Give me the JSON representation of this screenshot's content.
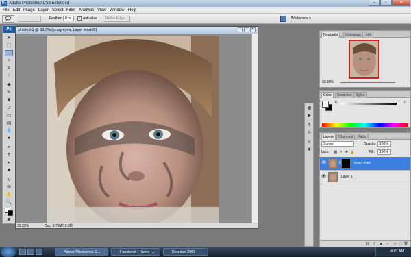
{
  "window": {
    "title": "Adobe Photoshop CS3 Extended",
    "app_badge": "Ps",
    "controls": {
      "minimize": "–",
      "maximize": "▫",
      "close": "✕"
    }
  },
  "menu": [
    "File",
    "Edit",
    "Image",
    "Layer",
    "Select",
    "Filter",
    "Analysis",
    "View",
    "Window",
    "Help"
  ],
  "options": {
    "tool_icon": "lasso-icon",
    "feather_label": "Feather:",
    "feather_value": "0 px",
    "antialias_label": "Anti-alias",
    "antialias_checked": true,
    "refine_edge_label": "Refine Edge...",
    "workspace_label": "Workspace ▾"
  },
  "document": {
    "title": "Untitled-1 @ 33.3% (scary eyes, Layer Mask/8)",
    "zoom": "33.33%",
    "doc_info": "Doc: 9.76M/19.0M"
  },
  "panels": {
    "navigator": {
      "tabs": [
        "Navigator",
        "Histogram",
        "Info"
      ],
      "zoom": "33.33%"
    },
    "color": {
      "tabs": [
        "Color",
        "Swatches",
        "Styles"
      ],
      "channel_label": "K",
      "channel_value": "0",
      "foreground": "#ffffff",
      "background": "#000000"
    },
    "layers": {
      "tabs": [
        "Layers",
        "Channels",
        "Paths"
      ],
      "blend_mode": "Screen",
      "opacity_label": "Opacity:",
      "opacity_value": "100%",
      "lock_label": "Lock:",
      "fill_label": "Fill:",
      "fill_value": "100%",
      "items": [
        {
          "name": "scary eyes",
          "selected": true,
          "has_mask": true
        },
        {
          "name": "Layer 1",
          "selected": false,
          "has_mask": false
        }
      ]
    }
  },
  "taskbar": {
    "tasks": [
      {
        "label": "Adobe Photoshop C...",
        "icon": "photoshop-icon",
        "active": true
      },
      {
        "label": "Facebook | Home -...",
        "icon": "firefox-icon",
        "active": false
      },
      {
        "label": "Reunion 2009",
        "icon": "folder-icon",
        "active": false
      }
    ],
    "clock": "4:07 AM"
  },
  "colors": {
    "accent_selected_layer": "#3d7fe0",
    "nav_box": "#d42020"
  }
}
